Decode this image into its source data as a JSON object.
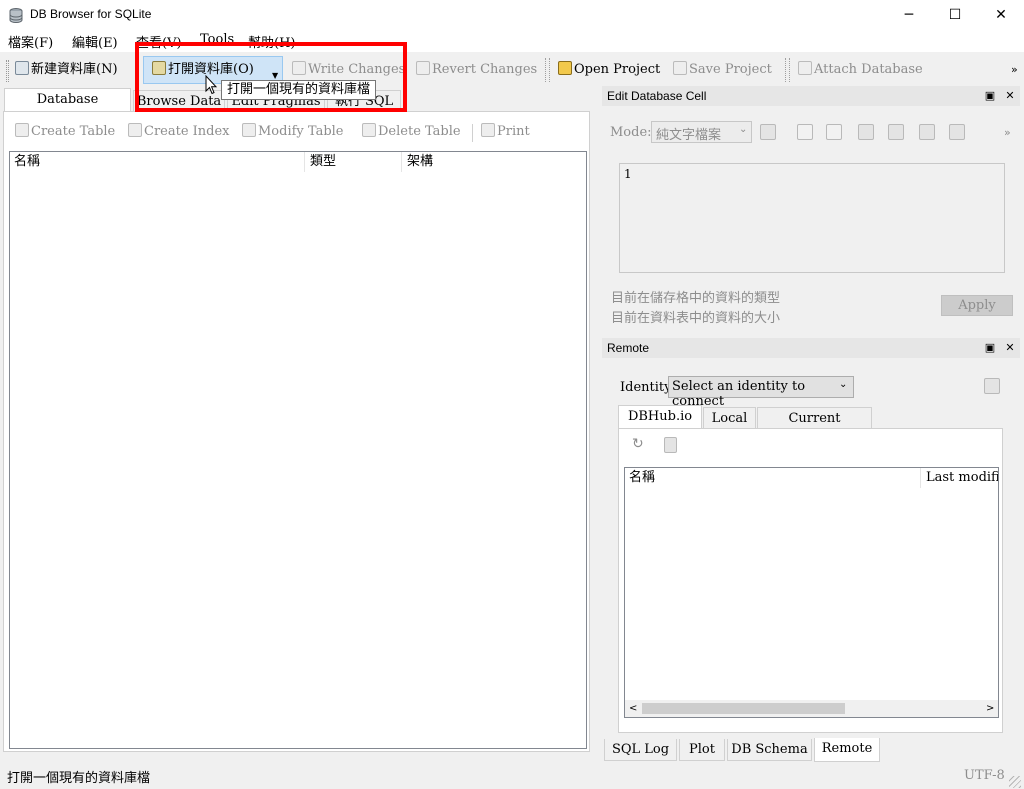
{
  "window": {
    "title": "DB Browser for SQLite",
    "minimize": "─",
    "maximize": "☐",
    "close": "✕"
  },
  "menu": [
    "檔案(F)",
    "編輯(E)",
    "查看(V)",
    "Tools",
    "幫助(H)"
  ],
  "toolbar": {
    "new_db": "新建資料庫(N)",
    "open_db": "打開資料庫(O)",
    "write_changes": "Write Changes",
    "revert_changes": "Revert Changes",
    "open_project": "Open Project",
    "save_project": "Save Project",
    "attach_db": "Attach Database",
    "more": "»"
  },
  "tooltip": "打開一個現有的資料庫檔",
  "tabs": [
    "Database Structure",
    "Browse Data",
    "Edit Pragmas",
    "執行 SQL"
  ],
  "structure_toolbar": {
    "create_table": "Create Table",
    "create_index": "Create Index",
    "modify_table": "Modify Table",
    "delete_table": "Delete Table",
    "print": "Print"
  },
  "tree_columns": [
    "名稱",
    "類型",
    "架構"
  ],
  "edit_cell": {
    "title": "Edit Database Cell",
    "mode_label": "Mode:",
    "mode_value": "純文字檔案",
    "more": "»",
    "content": "1",
    "type_text": "目前在儲存格中的資料的類型",
    "size_text": "目前在資料表中的資料的大小",
    "apply": "Apply"
  },
  "remote": {
    "title": "Remote",
    "identity_label": "Identity",
    "identity_value": "Select an identity to connect",
    "tabs": [
      "DBHub.io",
      "Local",
      "Current Database"
    ],
    "columns": [
      "名稱",
      "Last modified"
    ]
  },
  "bottom_tabs": [
    "SQL Log",
    "Plot",
    "DB Schema",
    "Remote"
  ],
  "status": {
    "message": "打開一個現有的資料庫檔",
    "encoding": "UTF-8"
  },
  "colors": {
    "highlight": "#ff0000",
    "tab_active": "#ffffff"
  }
}
